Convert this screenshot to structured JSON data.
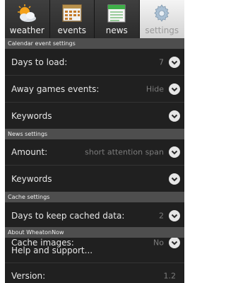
{
  "tabs": [
    {
      "label": "weather",
      "icon": "weather-sun-cloud-icon",
      "active": false
    },
    {
      "label": "events",
      "icon": "calendar-icon",
      "active": false
    },
    {
      "label": "news",
      "icon": "newspaper-icon",
      "active": false
    },
    {
      "label": "settings",
      "icon": "gear-icon",
      "active": true
    }
  ],
  "sections": {
    "calendar": {
      "title": "Calendar event settings",
      "days_to_load": {
        "label": "Days to load:",
        "value": "7"
      },
      "away_games": {
        "label": "Away games events:",
        "value": "Hide"
      },
      "keywords": {
        "label": "Keywords"
      }
    },
    "news": {
      "title": "News settings",
      "amount": {
        "label": "Amount:",
        "value": "short attention span"
      },
      "keywords": {
        "label": "Keywords"
      }
    },
    "cache": {
      "title": "Cache settings",
      "days_to_keep": {
        "label": "Days to keep cached data:",
        "value": "2"
      },
      "cache_images": {
        "label": "Cache images:",
        "value": "No"
      }
    },
    "about": {
      "title": "About WheatonNow",
      "help": {
        "label": "Help and support..."
      },
      "version": {
        "label": "Version:",
        "value": "1.2"
      }
    }
  },
  "colors": {
    "background": "#202020",
    "section_header": "#4e4e4e",
    "value_text": "#7c7c7c",
    "active_tab": "#dedede"
  }
}
